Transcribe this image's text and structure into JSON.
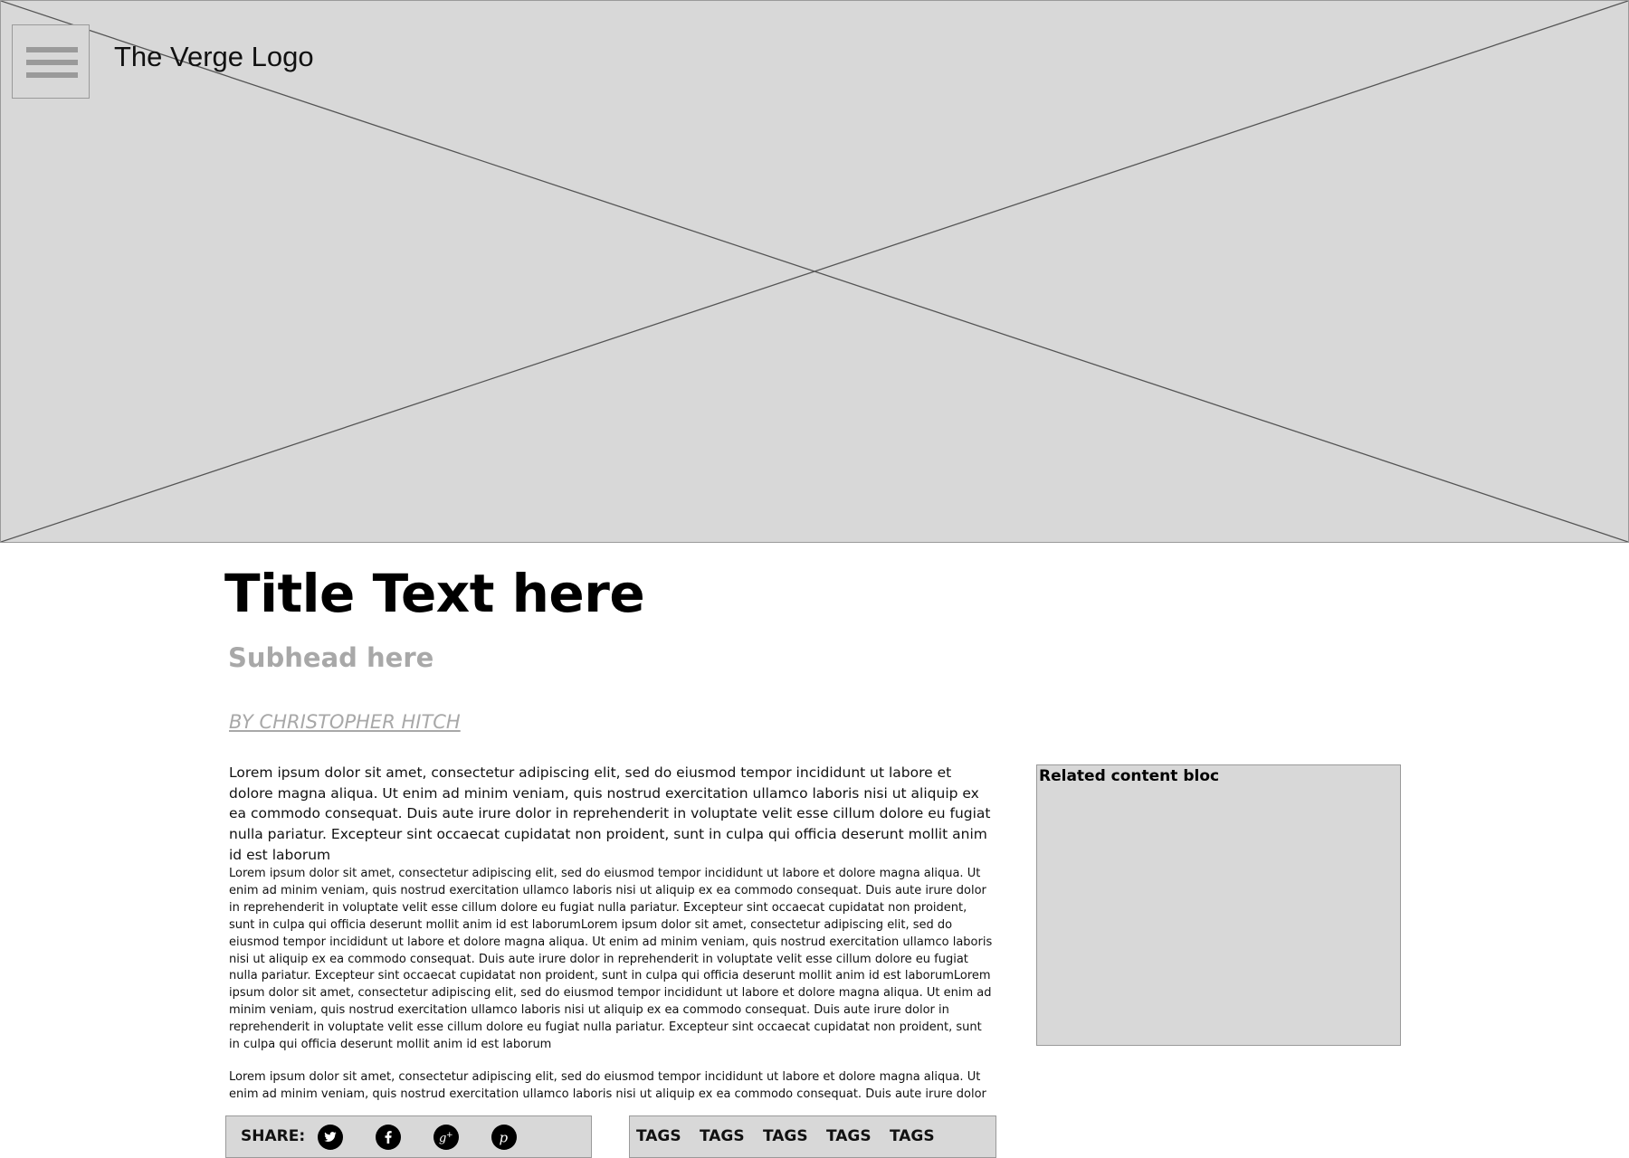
{
  "header": {
    "logo_text": "The Verge Logo",
    "menu_icon": "hamburger-menu-icon"
  },
  "hero": {
    "placeholder": "image-placeholder"
  },
  "article": {
    "title": "Title Text here",
    "subhead": "Subhead here",
    "byline": "BY CHRISTOPHER HITCH",
    "lead": "Lorem ipsum dolor sit amet, consectetur adipiscing elit, sed do eiusmod tempor incididunt ut labore et dolore magna aliqua. Ut enim ad minim veniam, quis nostrud exercitation ullamco laboris nisi ut aliquip ex ea commodo consequat. Duis aute irure dolor in reprehenderit in voluptate velit esse cillum dolore eu fugiat nulla pariatur. Excepteur sint occaecat cupidatat non proident, sunt in culpa qui officia deserunt mollit anim id est laborum",
    "paragraphs": [
      "Lorem ipsum dolor sit amet, consectetur adipiscing elit, sed do eiusmod tempor incididunt ut labore et dolore magna aliqua. Ut enim ad minim veniam, quis nostrud exercitation ullamco laboris nisi ut aliquip ex ea commodo consequat. Duis aute irure dolor in reprehenderit in voluptate velit esse cillum dolore eu fugiat nulla pariatur. Excepteur sint occaecat cupidatat non proident, sunt in culpa qui officia deserunt mollit anim id est laborumLorem ipsum dolor sit amet, consectetur adipiscing elit, sed do eiusmod tempor incididunt ut labore et dolore magna aliqua. Ut enim ad minim veniam, quis nostrud exercitation ullamco laboris nisi ut aliquip ex ea commodo consequat. Duis aute irure dolor in reprehenderit in voluptate velit esse cillum dolore eu fugiat nulla pariatur. Excepteur sint occaecat cupidatat non proident, sunt in culpa qui officia deserunt mollit anim id est laborumLorem ipsum dolor sit amet, consectetur adipiscing elit, sed do eiusmod tempor incididunt ut labore et dolore magna aliqua. Ut enim ad minim veniam, quis nostrud exercitation ullamco laboris nisi ut aliquip ex ea commodo consequat. Duis aute irure dolor in reprehenderit in voluptate velit esse cillum dolore eu fugiat nulla pariatur. Excepteur sint occaecat cupidatat non proident, sunt in culpa qui officia deserunt mollit anim id est laborum",
      "Lorem ipsum dolor sit amet, consectetur adipiscing elit, sed do eiusmod tempor incididunt ut labore et dolore magna aliqua. Ut enim ad minim veniam, quis nostrud exercitation ullamco laboris nisi ut aliquip ex ea commodo consequat. Duis aute irure dolor in"
    ]
  },
  "sidebar": {
    "related_label": "Related content bloc"
  },
  "share": {
    "label": "SHARE:",
    "icons": [
      "twitter-icon",
      "facebook-icon",
      "google-plus-icon",
      "pinterest-icon"
    ]
  },
  "tags": {
    "items": [
      "TAGS",
      "TAGS",
      "TAGS",
      "TAGS",
      "TAGS"
    ]
  },
  "colors": {
    "placeholder_fill": "#d8d8d8",
    "placeholder_border": "#9a9a9a",
    "muted_text": "#a8a8a8",
    "text": "#111111"
  }
}
